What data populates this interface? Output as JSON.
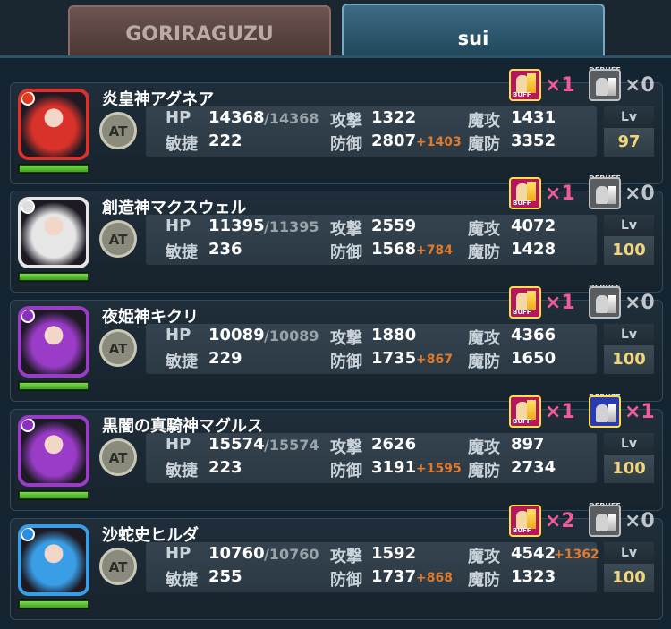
{
  "tabs": [
    {
      "label": "GORIRAGUZU",
      "active": false
    },
    {
      "label": "sui",
      "active": true
    }
  ],
  "stat_labels": {
    "hp": "HP",
    "atk": "攻撃",
    "matk": "魔攻",
    "agi": "敏捷",
    "def": "防御",
    "mdef": "魔防",
    "lv": "Lv",
    "at": "AT",
    "buff": "BUFF",
    "debuff": "DEBUFF"
  },
  "units": [
    {
      "name": "炎皇神アグネア",
      "hp": "14368",
      "hp_max": "/14368",
      "atk": "1322",
      "atk_bonus": "",
      "matk": "1431",
      "matk_bonus": "",
      "agi": "222",
      "def": "2807",
      "def_bonus": "+1403",
      "mdef": "3352",
      "lv": "97",
      "buff_count": "×1",
      "debuff_count": "×0",
      "frame_color": "#d9322a",
      "attr_color": "#e23a1c",
      "hp_fill": 1.0,
      "debuff_active": false
    },
    {
      "name": "創造神マクスウェル",
      "hp": "11395",
      "hp_max": "/11395",
      "atk": "2559",
      "atk_bonus": "",
      "matk": "4072",
      "matk_bonus": "",
      "agi": "236",
      "def": "1568",
      "def_bonus": "+784",
      "mdef": "1428",
      "lv": "100",
      "buff_count": "×1",
      "debuff_count": "×0",
      "frame_color": "#e6e6e6",
      "attr_color": "#dddddd",
      "hp_fill": 1.0,
      "debuff_active": false
    },
    {
      "name": "夜姫神キクリ",
      "hp": "10089",
      "hp_max": "/10089",
      "atk": "1880",
      "atk_bonus": "",
      "matk": "4366",
      "matk_bonus": "",
      "agi": "229",
      "def": "1735",
      "def_bonus": "+867",
      "mdef": "1650",
      "lv": "100",
      "buff_count": "×1",
      "debuff_count": "×0",
      "frame_color": "#9a3cc8",
      "attr_color": "#8a2fc0",
      "hp_fill": 1.0,
      "debuff_active": false
    },
    {
      "name": "黒闇の真騎神マグルス",
      "hp": "15574",
      "hp_max": "/15574",
      "atk": "2626",
      "atk_bonus": "",
      "matk": "897",
      "matk_bonus": "",
      "agi": "223",
      "def": "3191",
      "def_bonus": "+1595",
      "mdef": "2734",
      "lv": "100",
      "buff_count": "×1",
      "debuff_count": "×1",
      "frame_color": "#9a3cc8",
      "attr_color": "#8a2fc0",
      "hp_fill": 1.0,
      "debuff_active": true
    },
    {
      "name": "沙蛇史ヒルダ",
      "hp": "10760",
      "hp_max": "/10760",
      "atk": "1592",
      "atk_bonus": "",
      "matk": "4542",
      "matk_bonus": "+1362",
      "agi": "255",
      "def": "1737",
      "def_bonus": "+868",
      "mdef": "1323",
      "lv": "100",
      "buff_count": "×2",
      "debuff_count": "×0",
      "frame_color": "#3a9ee6",
      "attr_color": "#2a8ee0",
      "hp_fill": 1.0,
      "debuff_active": false
    }
  ]
}
